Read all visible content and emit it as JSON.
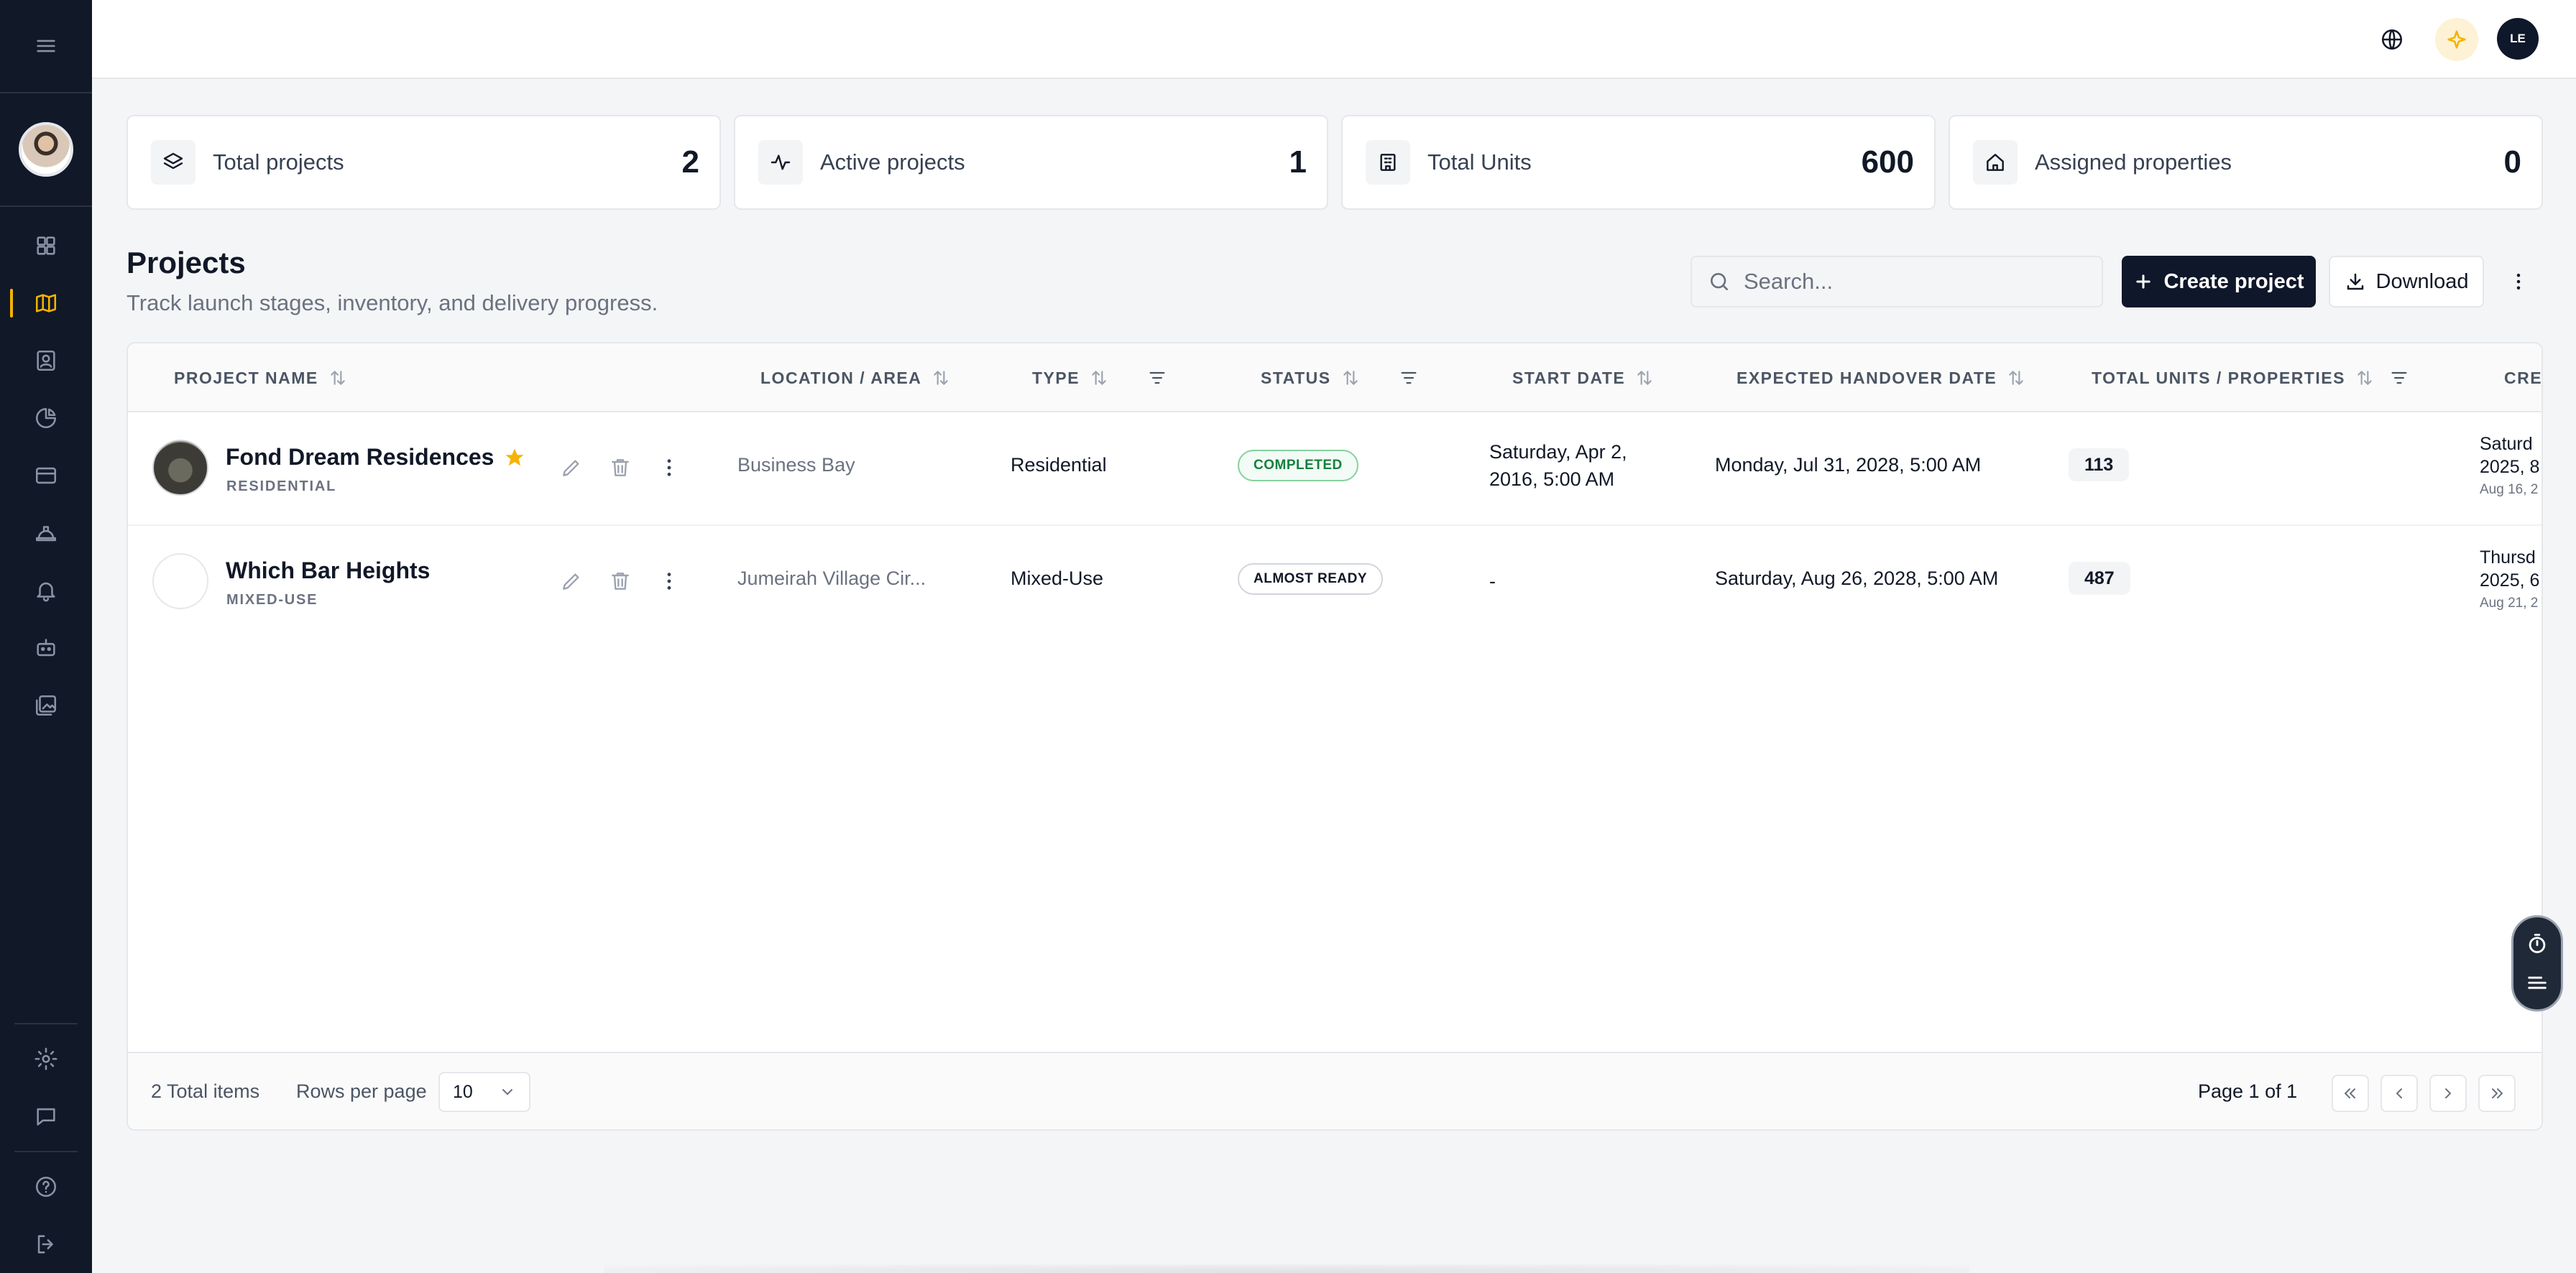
{
  "topbar": {
    "user_initials": "LE"
  },
  "stats": [
    {
      "label": "Total projects",
      "value": "2",
      "icon": "layers-icon"
    },
    {
      "label": "Active projects",
      "value": "1",
      "icon": "activity-icon"
    },
    {
      "label": "Total Units",
      "value": "600",
      "icon": "building-icon"
    },
    {
      "label": "Assigned properties",
      "value": "0",
      "icon": "home-icon"
    }
  ],
  "header": {
    "title": "Projects",
    "subtitle": "Track launch stages, inventory, and delivery progress.",
    "search_placeholder": "Search...",
    "create_label": "Create project",
    "download_label": "Download"
  },
  "table": {
    "columns": {
      "name": "PROJECT NAME",
      "location": "LOCATION / AREA",
      "type": "TYPE",
      "status": "STATUS",
      "start": "START DATE",
      "handover": "EXPECTED HANDOVER DATE",
      "units": "TOTAL UNITS / PROPERTIES",
      "created": "CREA"
    },
    "rows": [
      {
        "name": "Fond Dream Residences",
        "category": "RESIDENTIAL",
        "starred": true,
        "location": "Business Bay",
        "type": "Residential",
        "status": "COMPLETED",
        "start_line1": "Saturday, Apr 2,",
        "start_line2": "2016, 5:00 AM",
        "handover": "Monday, Jul 31, 2028, 5:00 AM",
        "units": "113",
        "created_line1": "Saturd",
        "created_line2": "2025, 8",
        "created_small": "Aug 16, 2"
      },
      {
        "name": "Which Bar Heights",
        "category": "MIXED-USE",
        "starred": false,
        "location": "Jumeirah Village Cir...",
        "type": "Mixed-Use",
        "status": "ALMOST READY",
        "start_line1": "-",
        "start_line2": "",
        "handover": "Saturday, Aug 26, 2028, 5:00 AM",
        "units": "487",
        "created_line1": "Thursd",
        "created_line2": "2025, 6",
        "created_small": "Aug 21, 2"
      }
    ]
  },
  "footer": {
    "total_items": "2 Total items",
    "rows_per_page_label": "Rows per page",
    "rows_per_page_value": "10",
    "page_info": "Page 1 of 1"
  },
  "colors": {
    "accent": "#f5b301",
    "sidebar": "#111827",
    "primary_button": "#0f172a",
    "completed": "#15803d"
  }
}
